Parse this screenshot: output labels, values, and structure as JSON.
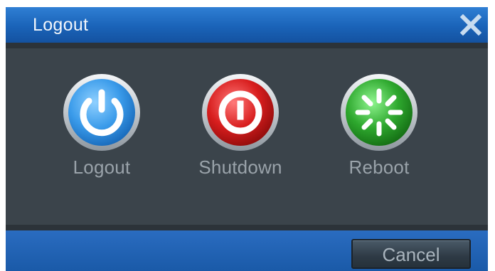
{
  "dialog": {
    "title": "Logout",
    "close_icon": "close-icon"
  },
  "options": [
    {
      "label": "Logout",
      "icon": "power-icon",
      "color": "#3a9bea"
    },
    {
      "label": "Shutdown",
      "icon": "shutdown-icon",
      "color": "#d81e1e"
    },
    {
      "label": "Reboot",
      "icon": "reboot-icon",
      "color": "#2ea82e"
    }
  ],
  "footer": {
    "cancel_label": "Cancel"
  }
}
